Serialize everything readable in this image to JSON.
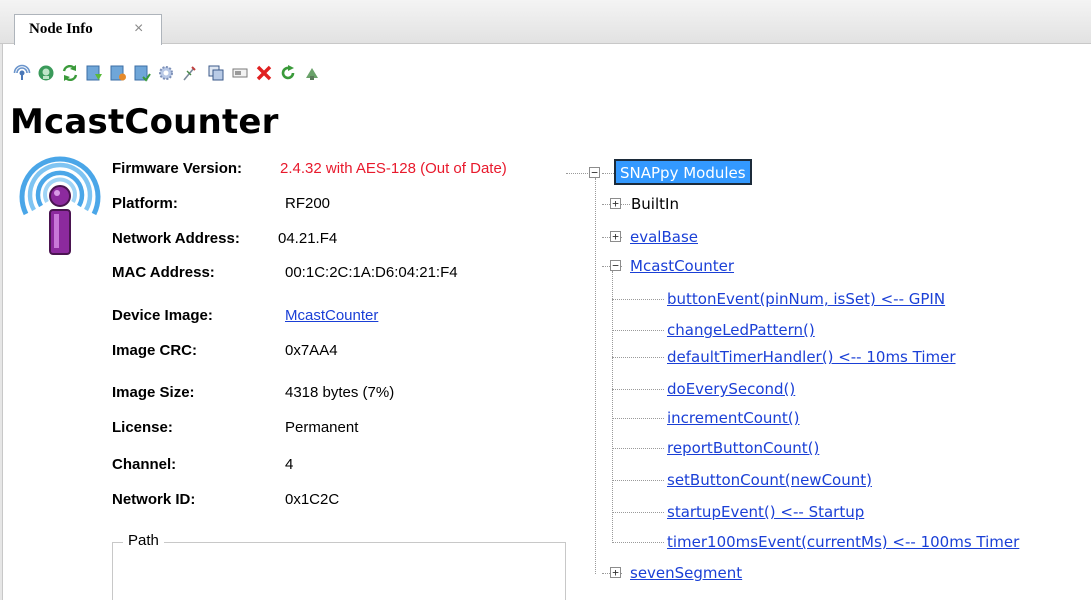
{
  "tab": {
    "title": "Node Info",
    "close": "×"
  },
  "toolbar": [
    {
      "name": "ping-icon"
    },
    {
      "name": "query-icon"
    },
    {
      "name": "refresh-icon"
    },
    {
      "name": "upload-image-icon"
    },
    {
      "name": "erase-image-icon"
    },
    {
      "name": "reboot-image-icon"
    },
    {
      "name": "settings-icon"
    },
    {
      "name": "script-icon"
    },
    {
      "name": "copy-icon"
    },
    {
      "name": "console-icon"
    },
    {
      "name": "delete-icon"
    },
    {
      "name": "refresh-green-icon"
    },
    {
      "name": "forward-icon"
    }
  ],
  "node": {
    "name": "McastCounter",
    "properties": [
      {
        "label": "Firmware Version:",
        "value": "2.4.32 with AES-128 (Out of Date)"
      },
      {
        "label": "Platform:",
        "value": "RF200"
      },
      {
        "label": "Network Address:",
        "value": "04.21.F4"
      },
      {
        "label": "MAC Address:",
        "value": "00:1C:2C:1A:D6:04:21:F4"
      },
      {
        "label": "Device Image:",
        "value": "McastCounter"
      },
      {
        "label": "Image CRC:",
        "value": "0x7AA4"
      },
      {
        "label": "Image Size:",
        "value": "4318 bytes (7%)"
      },
      {
        "label": "License:",
        "value": "Permanent"
      },
      {
        "label": "Channel:",
        "value": "4"
      },
      {
        "label": "Network ID:",
        "value": "0x1C2C"
      }
    ],
    "path_label": "Path"
  },
  "tree": {
    "root": "SNAPpy Modules",
    "modules": [
      {
        "label": "BuiltIn",
        "expander": "+"
      },
      {
        "label": "evalBase",
        "expander": "+"
      },
      {
        "label": "McastCounter",
        "expander": "−"
      },
      {
        "label": "sevenSegment",
        "expander": "+"
      }
    ],
    "functions": [
      "buttonEvent(pinNum, isSet) <-- GPIN",
      "changeLedPattern()",
      "defaultTimerHandler() <-- 10ms Timer",
      "doEverySecond()",
      "incrementCount()",
      "reportButtonCount()",
      "setButtonCount(newCount)",
      "startupEvent() <-- Startup",
      "timer100msEvent(currentMs) <-- 100ms Timer"
    ],
    "root_expander": "−"
  },
  "colors": {
    "accent": "#3399ff",
    "link": "#1a3fd6",
    "warning": "#e8192c"
  }
}
